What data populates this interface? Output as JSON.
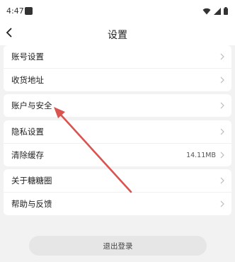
{
  "status_bar": {
    "time": "4:47",
    "icons": [
      "app-icon",
      "wifi-icon",
      "signal-icon",
      "battery-icon"
    ]
  },
  "header": {
    "title": "设置",
    "back_icon": "back-arrow-icon"
  },
  "groups": [
    {
      "items": [
        {
          "label": "账号设置"
        },
        {
          "label": "收货地址"
        }
      ]
    },
    {
      "items": [
        {
          "label": "账户与安全"
        }
      ]
    },
    {
      "items": [
        {
          "label": "隐私设置"
        },
        {
          "label": "清除缓存",
          "value": "14.11MB"
        }
      ]
    },
    {
      "items": [
        {
          "label": "关于糖糖圈"
        },
        {
          "label": "帮助与反馈"
        }
      ]
    }
  ],
  "logout_label": "退出登录",
  "colors": {
    "background": "#f2f2f2",
    "card": "#ffffff",
    "annotation_arrow": "#d9534f",
    "logout_button": "#e6e6e6"
  }
}
